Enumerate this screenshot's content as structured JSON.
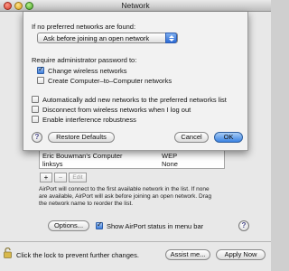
{
  "window": {
    "title": "Network"
  },
  "sheet": {
    "no_preferred_label": "If no preferred networks are found:",
    "no_preferred_value": "Ask before joining an open network",
    "admin_label": "Require administrator password to:",
    "admin_options": [
      {
        "label": "Change wireless networks",
        "checked": true
      },
      {
        "label": "Create Computer–to–Computer networks",
        "checked": false
      }
    ],
    "options": [
      {
        "label": "Automatically add new networks to the preferred networks list",
        "checked": false
      },
      {
        "label": "Disconnect from wireless networks when I log out",
        "checked": false
      },
      {
        "label": "Enable interference robustness",
        "checked": false
      }
    ],
    "help_label": "?",
    "restore_label": "Restore Defaults",
    "cancel_label": "Cancel",
    "ok_label": "OK"
  },
  "networks": {
    "rows": [
      {
        "name": "Eric Bouwman's Computer",
        "security": "WEP"
      },
      {
        "name": "linksys",
        "security": "None"
      }
    ],
    "add_label": "+",
    "remove_label": "−",
    "edit_label": "Edit"
  },
  "info_lines": [
    "AirPort will connect to the first available network in the list. If none",
    "are available, AirPort will ask before joining an open network. Drag",
    "the network name to reorder the list."
  ],
  "bottom": {
    "options_label": "Options...",
    "show_status_label": "Show AirPort status in menu bar",
    "show_status_checked": true,
    "help_label": "?",
    "lock_text": "Click the lock to prevent further changes.",
    "assist_label": "Assist me...",
    "apply_label": "Apply Now"
  },
  "colors": {
    "accent": "#3a83e3"
  }
}
